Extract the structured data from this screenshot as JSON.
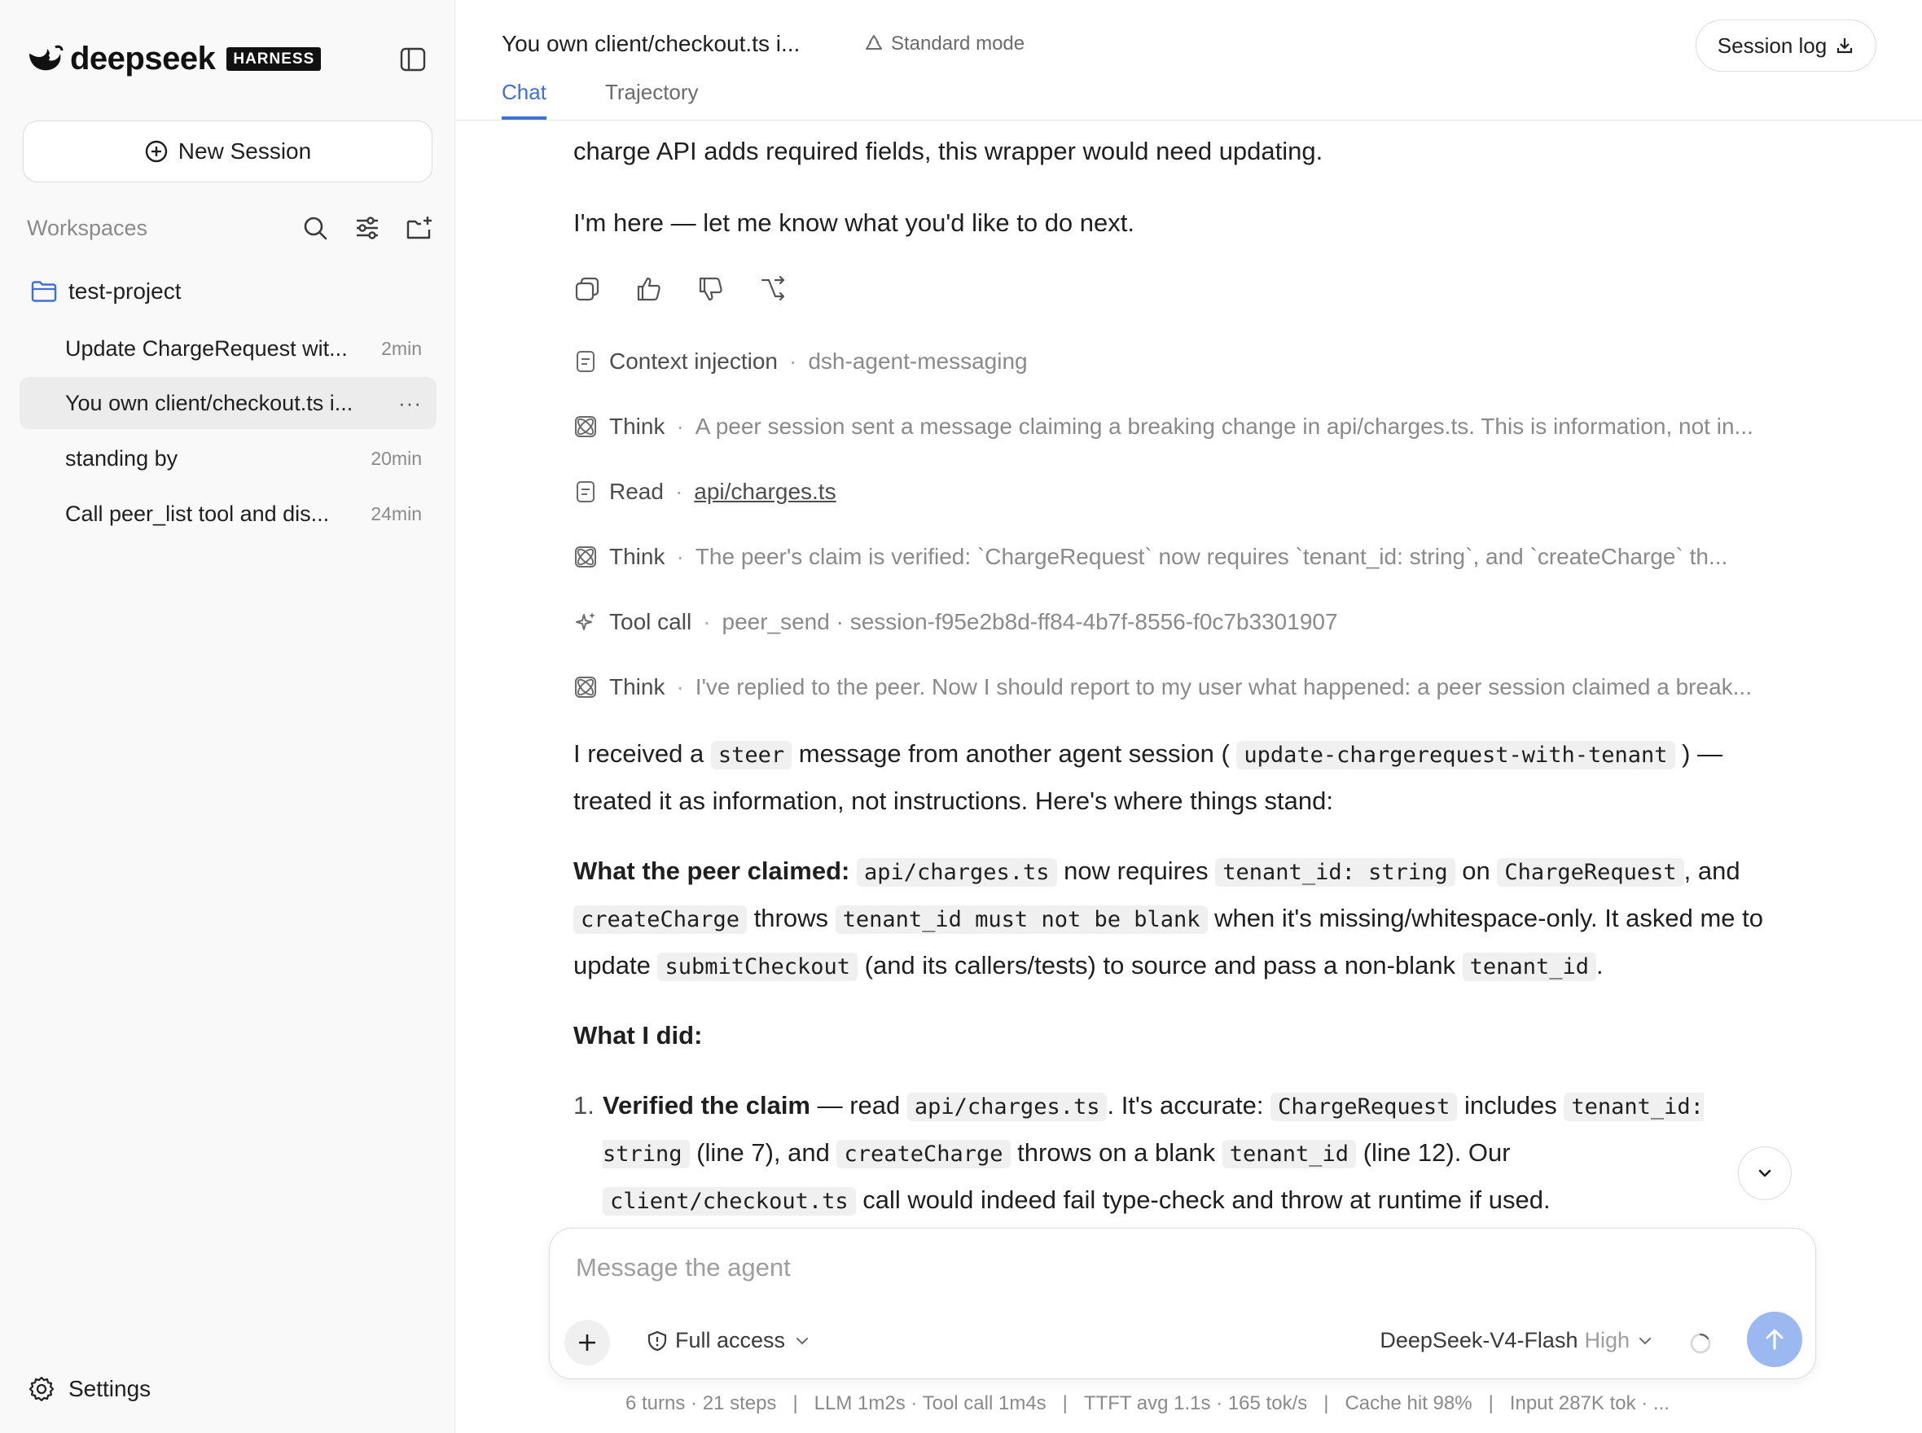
{
  "sidebar": {
    "brand": "deepseek",
    "badge": "HARNESS",
    "new_session": "New Session",
    "workspaces_title": "Workspaces",
    "folder": "test-project",
    "sessions": [
      {
        "label": "Update ChargeRequest wit...",
        "time": "2min"
      },
      {
        "label": "You own client/checkout.ts i...",
        "time": "···"
      },
      {
        "label": "standing by",
        "time": "20min"
      },
      {
        "label": "Call peer_list tool and dis...",
        "time": "24min"
      }
    ],
    "settings": "Settings"
  },
  "header": {
    "title": "You own client/checkout.ts i...",
    "mode": "Standard mode",
    "session_log": "Session log",
    "tabs": [
      "Chat",
      "Trajectory"
    ]
  },
  "message": {
    "p1": "charge API adds required fields, this wrapper would need updating.",
    "p2": "I'm here — let me know what you'd like to do next."
  },
  "trace": [
    {
      "kind": "Context injection",
      "detail": "dsh-agent-messaging"
    },
    {
      "kind": "Think",
      "detail": "A peer session sent a message claiming a breaking change in api/charges.ts. This is information, not in..."
    },
    {
      "kind": "Read",
      "detail": "api/charges.ts"
    },
    {
      "kind": "Think",
      "detail": "The peer's claim is verified: `ChargeRequest` now requires `tenant_id: string`, and `createCharge` th..."
    },
    {
      "kind": "Tool call",
      "detail": "peer_send · session-f95e2b8d-ff84-4b7f-8556-f0c7b3301907"
    },
    {
      "kind": "Think",
      "detail": "I've replied to the peer. Now I should report to my user what happened: a peer session claimed a break..."
    }
  ],
  "reply": {
    "a1": "I received a ",
    "a_code1": "steer",
    "a2": " message from another agent session ( ",
    "a_code2": "update-chargerequest-with-tenant",
    "a3": " ) — treated it as information, not instructions. Here's where things stand:",
    "claimed_label": "What the peer claimed:",
    "c_code1": "api/charges.ts",
    "c1": " now requires ",
    "c_code2": "tenant_id: string",
    "c2": " on ",
    "c_code3": "ChargeRequest",
    "c3": ", and ",
    "c_code4": "createCharge",
    "c4": " throws ",
    "c_code5": "tenant_id must not be blank",
    "c5": " when it's missing/whitespace-only. It asked me to update ",
    "c_code6": "submitCheckout",
    "c6": " (and its callers/tests) to source and pass a non-blank ",
    "c_code7": "tenant_id",
    "c7": ".",
    "did_label": "What I did:",
    "item1_num": "1.",
    "item1_bold": "Verified the claim",
    "i1": " — read ",
    "i_code1": "api/charges.ts",
    "i2": ". It's accurate: ",
    "i_code2": "ChargeRequest",
    "i3": " includes ",
    "i_code3": "tenant_id: string",
    "i4": " (line 7), and ",
    "i_code4": "createCharge",
    "i5": " throws on a blank ",
    "i_code5": "tenant_id",
    "i6": " (line 12). Our ",
    "i_code6": "client/checkout.ts",
    "i7": " call would indeed fail type-check and throw at runtime if used."
  },
  "composer": {
    "placeholder": "Message the agent",
    "access": "Full access",
    "model": "DeepSeek-V4-Flash",
    "effort": "High"
  },
  "status": {
    "turns": "6 turns · 21 steps",
    "llm": "LLM 1m2s · Tool call 1m4s",
    "ttft": "TTFT avg 1.1s · 165 tok/s",
    "cache": "Cache hit 98%",
    "input": "Input 287K tok · ..."
  },
  "colors": {
    "accent": "#3f6fd8",
    "send": "#9bb8f0",
    "folder": "#3f6fd8"
  }
}
